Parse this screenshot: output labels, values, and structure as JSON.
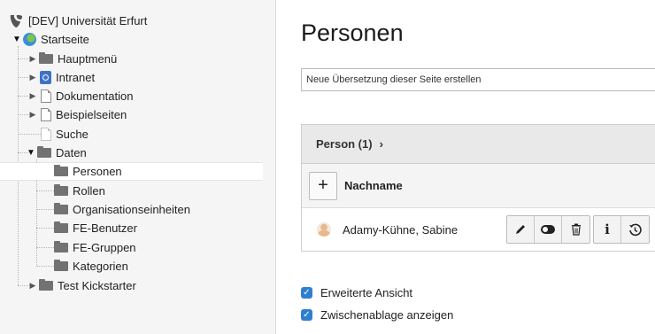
{
  "tree": {
    "root": {
      "label": "[DEV] Universität Erfurt",
      "icon": "typo3-logo-icon"
    },
    "nodes": [
      {
        "label": "Startseite",
        "icon": "globe-icon"
      },
      {
        "label": "Hauptmenü",
        "icon": "folder-icon"
      },
      {
        "label": "Intranet",
        "icon": "intranet-page-icon"
      },
      {
        "label": "Dokumentation",
        "icon": "page-icon"
      },
      {
        "label": "Beispielseiten",
        "icon": "page-icon"
      },
      {
        "label": "Suche",
        "icon": "page-icon"
      },
      {
        "label": "Daten",
        "icon": "folder-icon"
      },
      {
        "label": "Personen",
        "icon": "folder-icon",
        "active": true
      },
      {
        "label": "Rollen",
        "icon": "folder-icon"
      },
      {
        "label": "Organisationseinheiten",
        "icon": "folder-icon"
      },
      {
        "label": "FE-Benutzer",
        "icon": "folder-icon"
      },
      {
        "label": "FE-Gruppen",
        "icon": "folder-icon"
      },
      {
        "label": "Kategorien",
        "icon": "folder-icon"
      },
      {
        "label": "Test Kickstarter",
        "icon": "folder-icon"
      }
    ]
  },
  "main": {
    "title": "Personen",
    "translation_select": "Neue Übersetzung dieser Seite erstellen",
    "panel": {
      "header": "Person (1)",
      "new_button": "+",
      "column_label": "Nachname",
      "records": [
        {
          "name": "Adamy-Kühne, Sabine"
        }
      ],
      "actions": [
        "edit",
        "toggle-visibility",
        "delete",
        "info",
        "history"
      ]
    },
    "checkboxes": [
      {
        "label": "Erweiterte Ansicht",
        "checked": true
      },
      {
        "label": "Zwischenablage anzeigen",
        "checked": true
      }
    ]
  },
  "colors": {
    "accent": "#2f7fd0",
    "tree_bg": "#f5f5f5",
    "panel_head": "#e9e9e9"
  }
}
